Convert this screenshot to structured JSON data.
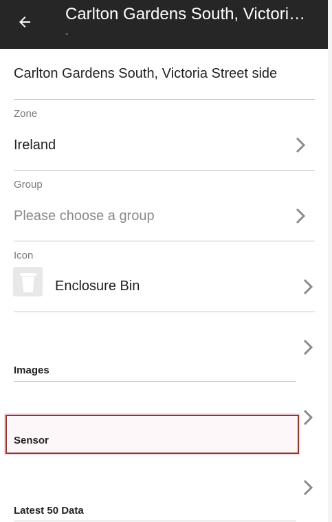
{
  "app_bar": {
    "title": "Carlton Gardens South, Victoria Street side",
    "subtitle": "-",
    "back_icon": "arrow-back-icon"
  },
  "form": {
    "name_value": "Carlton Gardens South, Victoria Street side",
    "zone": {
      "label": "Zone",
      "value": "Ireland"
    },
    "group": {
      "label": "Group",
      "placeholder": "Please choose a group"
    },
    "icon": {
      "label": "Icon",
      "value": "Enclosure Bin",
      "icon_name": "trash-bin-icon"
    },
    "sections": {
      "images": "Images",
      "sensor": "Sensor",
      "latest": "Latest 50 Data"
    }
  },
  "colors": {
    "app_bar": "#262626",
    "highlight_border": "#8b3a2a"
  }
}
